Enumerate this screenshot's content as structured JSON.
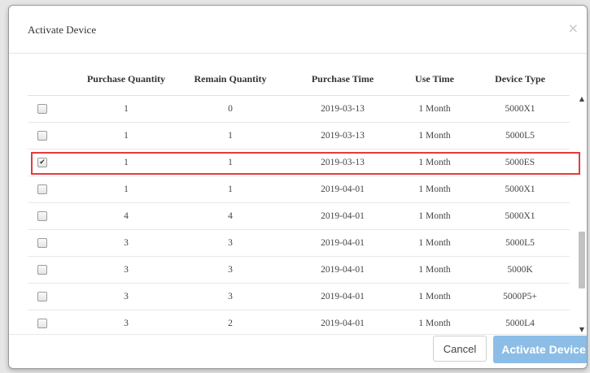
{
  "dialog": {
    "title": "Activate Device",
    "close_glyph": "×",
    "cancel_label": "Cancel",
    "activate_label": "Activate Device"
  },
  "table": {
    "headers": [
      "Purchase Quantity",
      "Remain Quantity",
      "Purchase Time",
      "Use Time",
      "Device Type"
    ],
    "rows": [
      {
        "checked": false,
        "purchase_qty": "1",
        "remain_qty": "0",
        "purchase_time": "2019-03-13",
        "use_time": "1 Month",
        "device_type": "5000X1"
      },
      {
        "checked": false,
        "purchase_qty": "1",
        "remain_qty": "1",
        "purchase_time": "2019-03-13",
        "use_time": "1 Month",
        "device_type": "5000L5"
      },
      {
        "checked": true,
        "purchase_qty": "1",
        "remain_qty": "1",
        "purchase_time": "2019-03-13",
        "use_time": "1 Month",
        "device_type": "5000ES"
      },
      {
        "checked": false,
        "purchase_qty": "1",
        "remain_qty": "1",
        "purchase_time": "2019-04-01",
        "use_time": "1 Month",
        "device_type": "5000X1"
      },
      {
        "checked": false,
        "purchase_qty": "4",
        "remain_qty": "4",
        "purchase_time": "2019-04-01",
        "use_time": "1 Month",
        "device_type": "5000X1"
      },
      {
        "checked": false,
        "purchase_qty": "3",
        "remain_qty": "3",
        "purchase_time": "2019-04-01",
        "use_time": "1 Month",
        "device_type": "5000L5"
      },
      {
        "checked": false,
        "purchase_qty": "3",
        "remain_qty": "3",
        "purchase_time": "2019-04-01",
        "use_time": "1 Month",
        "device_type": "5000K"
      },
      {
        "checked": false,
        "purchase_qty": "3",
        "remain_qty": "3",
        "purchase_time": "2019-04-01",
        "use_time": "1 Month",
        "device_type": "5000P5+"
      },
      {
        "checked": false,
        "purchase_qty": "3",
        "remain_qty": "2",
        "purchase_time": "2019-04-01",
        "use_time": "1 Month",
        "device_type": "5000L4"
      }
    ],
    "check_glyph": "✔"
  },
  "scrollbar": {
    "up_glyph": "▲",
    "down_glyph": "▼"
  },
  "colors": {
    "highlight_border": "#e53b3b",
    "primary_button": "#8cbde6"
  }
}
